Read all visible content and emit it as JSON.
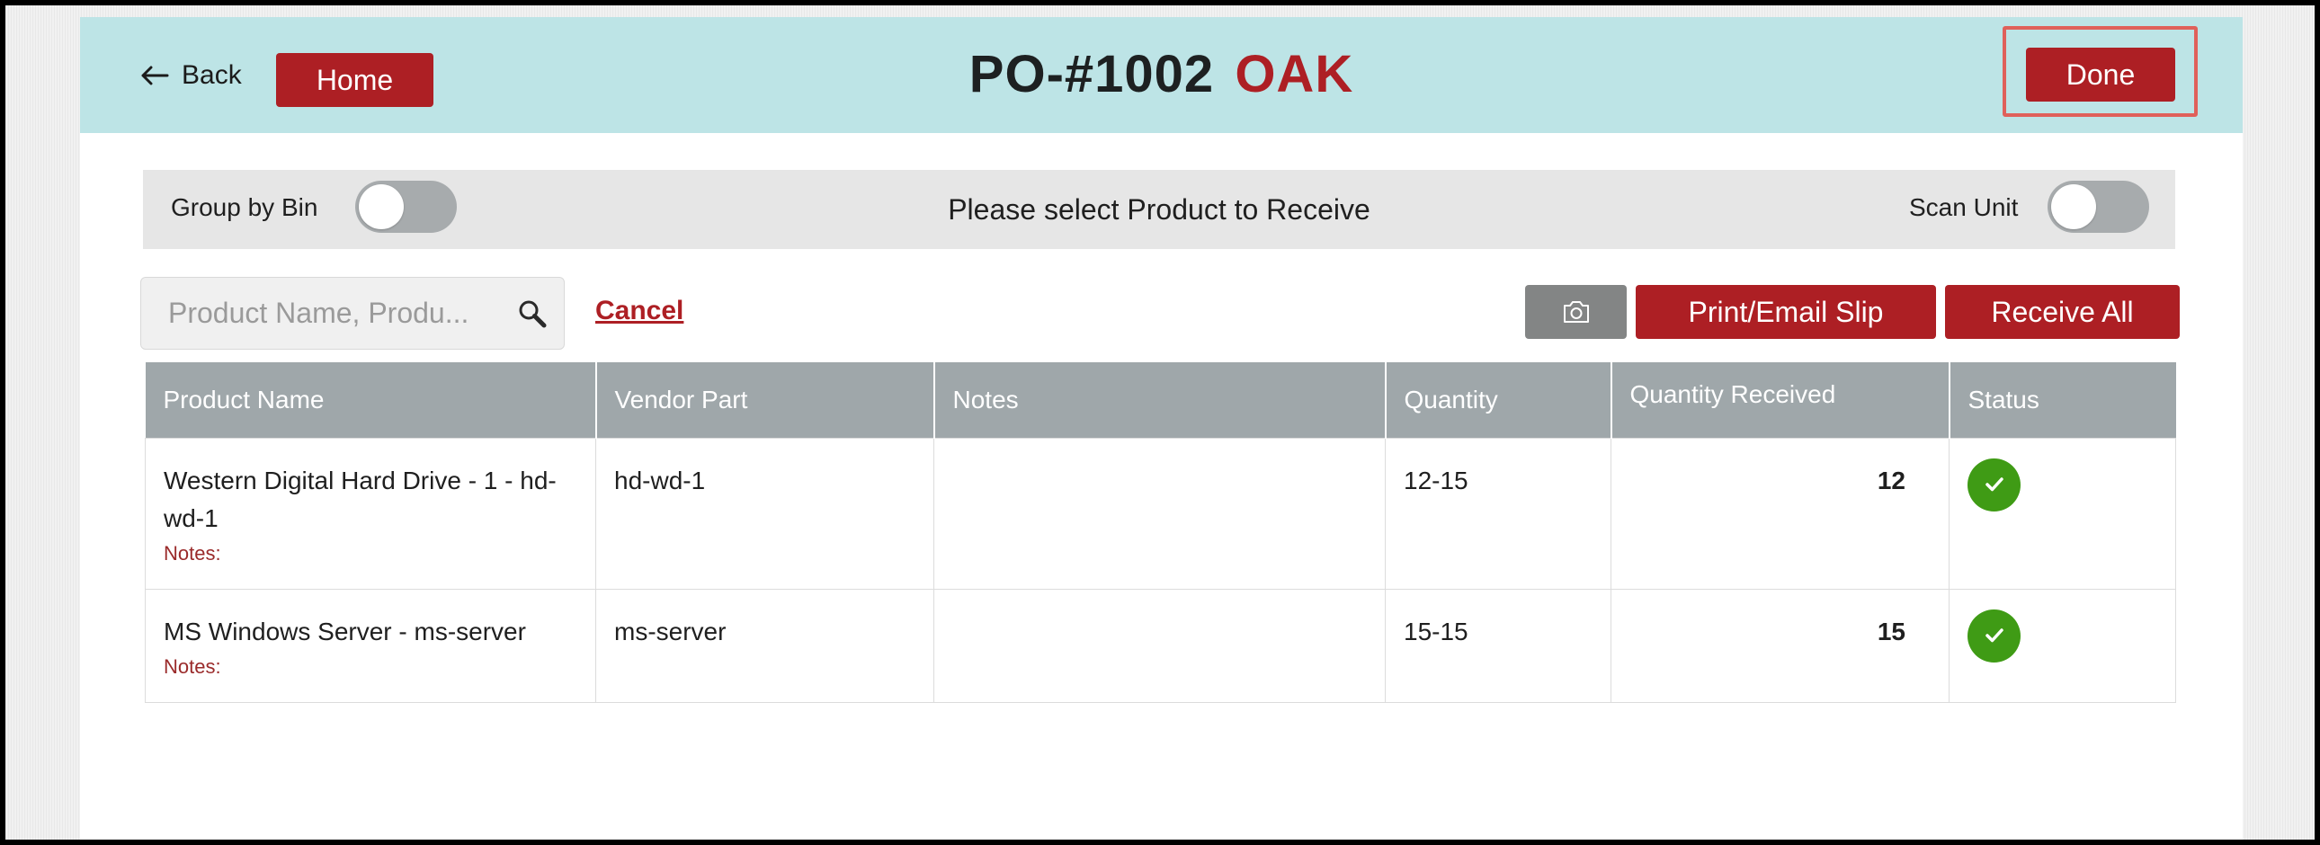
{
  "header": {
    "back_label": "Back",
    "home_label": "Home",
    "po_number": "PO-#1002",
    "po_vendor": "OAK",
    "done_label": "Done"
  },
  "options": {
    "group_by_bin_label": "Group by Bin",
    "group_by_bin_on": false,
    "instruction": "Please select Product to Receive",
    "scan_unit_label": "Scan Unit",
    "scan_unit_on": false
  },
  "search": {
    "placeholder": "Product Name, Produ...",
    "cancel_label": "Cancel",
    "camera_icon": "camera-icon",
    "print_label": "Print/Email Slip",
    "receive_all_label": "Receive All"
  },
  "table": {
    "columns": [
      "Product Name",
      "Vendor Part",
      "Notes",
      "Quantity",
      "Quantity Received",
      "Status"
    ],
    "rows": [
      {
        "product_name": "Western Digital Hard Drive - 1 - hd-wd-1",
        "notes_label": "Notes:",
        "vendor_part": "hd-wd-1",
        "notes": "",
        "quantity": "12-15",
        "quantity_received": "12",
        "status_icon": "check-icon"
      },
      {
        "product_name": "MS Windows Server - ms-server",
        "notes_label": "Notes:",
        "vendor_part": "ms-server",
        "notes": "",
        "quantity": "15-15",
        "quantity_received": "15",
        "status_icon": "check-icon"
      }
    ]
  },
  "colors": {
    "accent_red": "#ad1f24",
    "header_bg": "#bde4e6",
    "status_green": "#3f9b15",
    "table_header_bg": "#9fa7aa"
  }
}
